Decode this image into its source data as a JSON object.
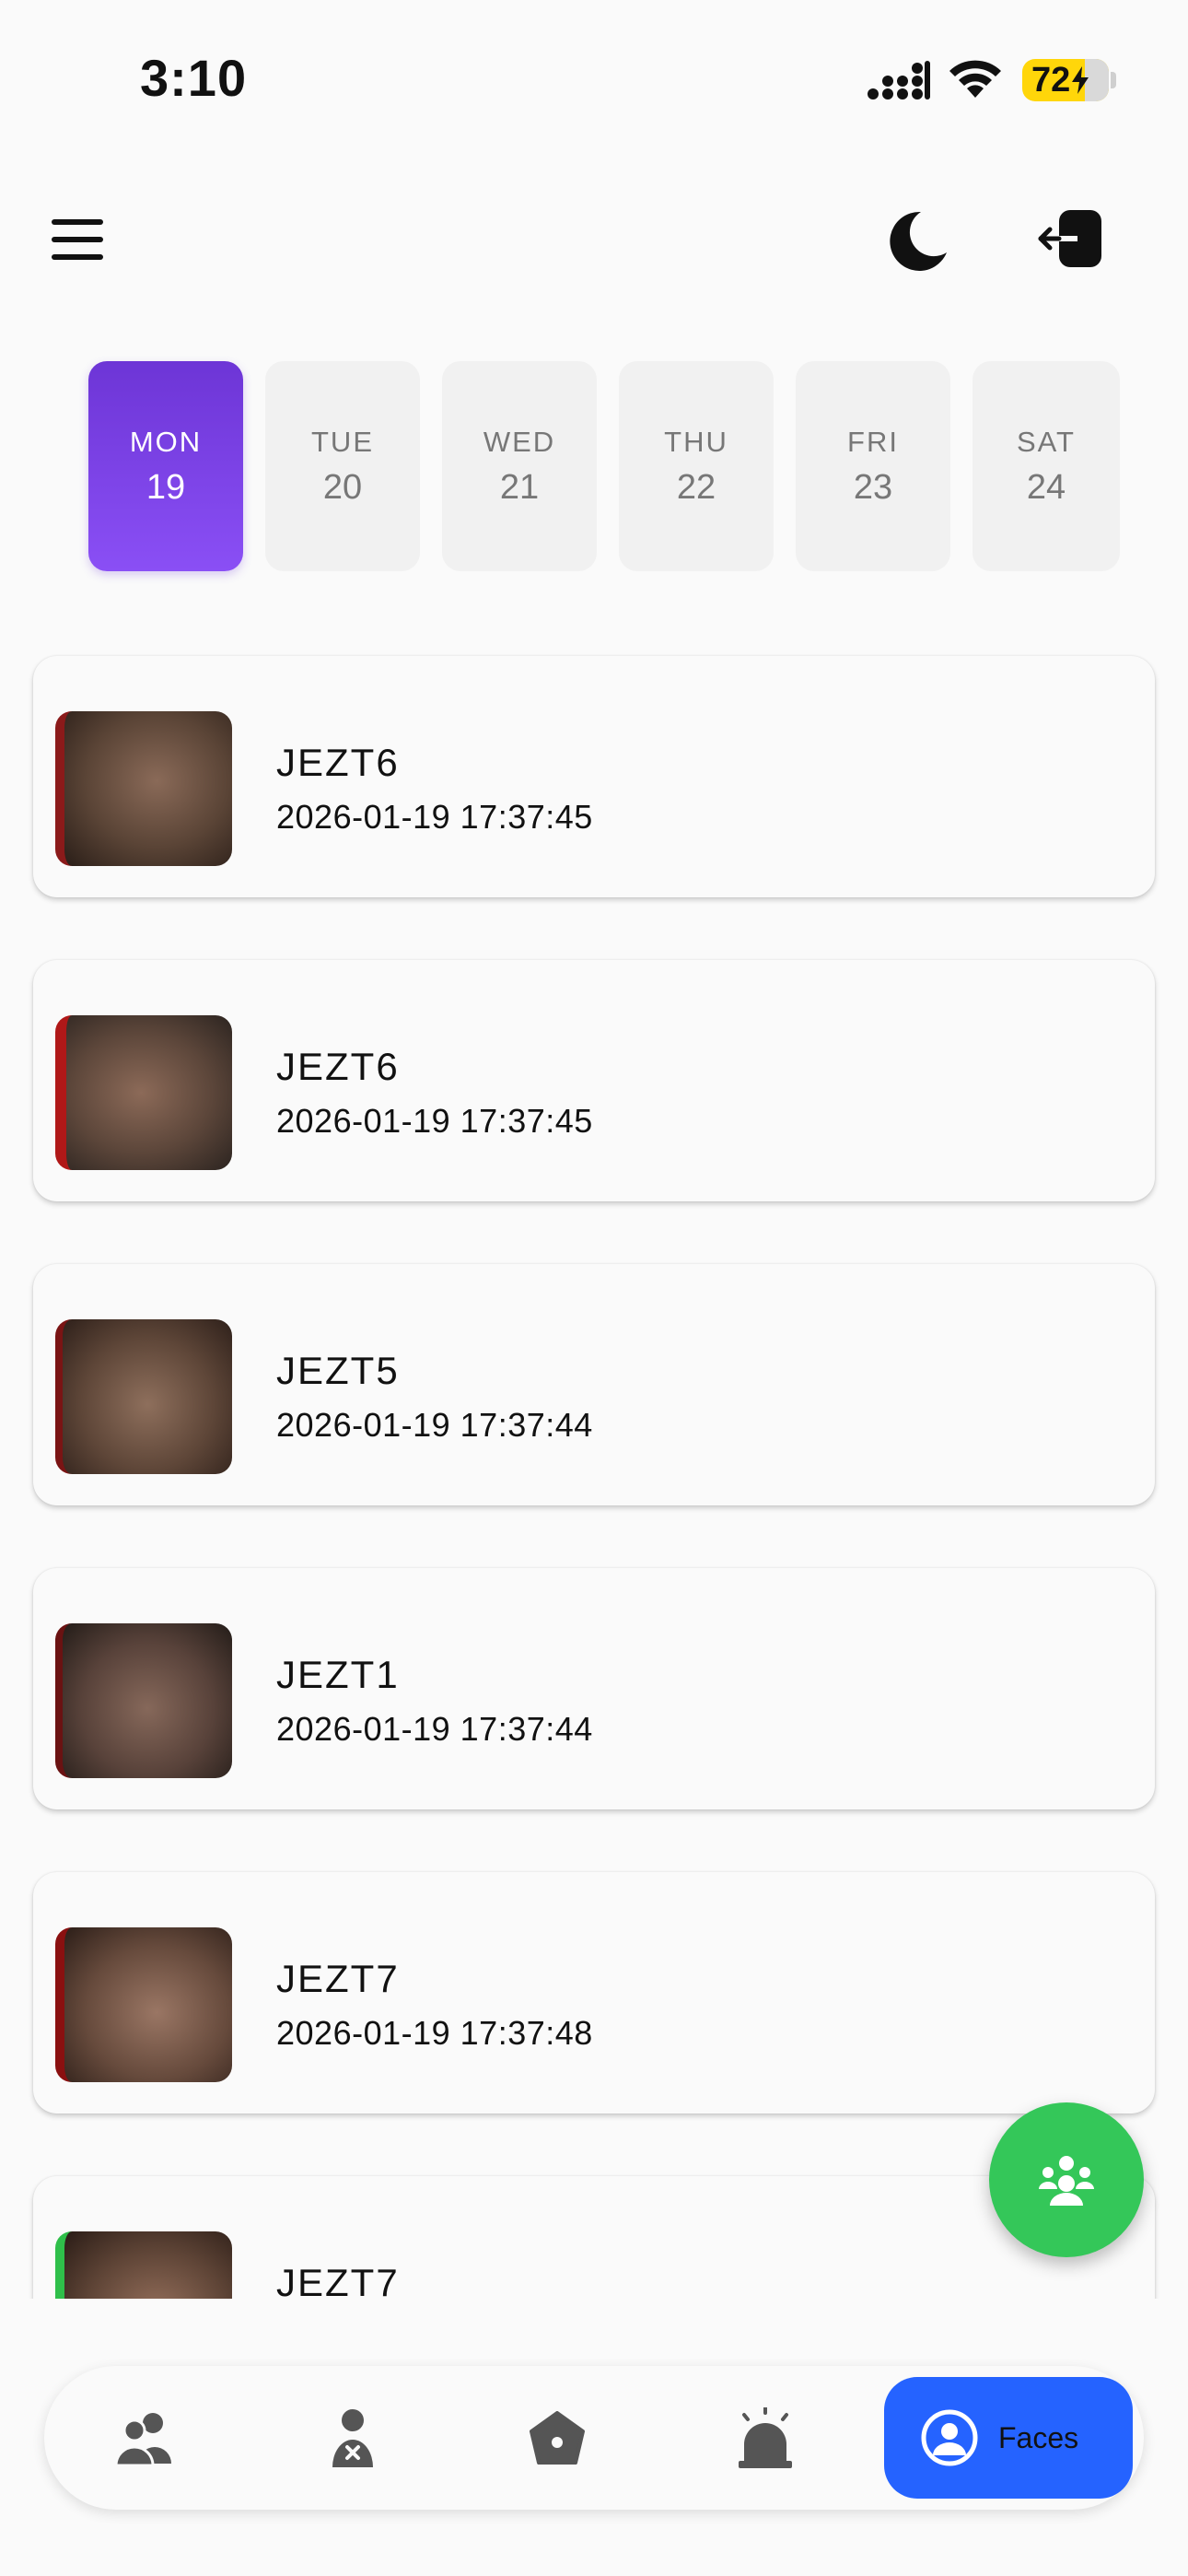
{
  "status_bar": {
    "time": "3:10",
    "battery": "72"
  },
  "header": {
    "menu_icon": "hamburger-menu-icon",
    "theme_icon": "moon-icon",
    "logout_icon": "logout-icon"
  },
  "date_strip": {
    "selected_index": 0,
    "days": [
      {
        "dow": "MON",
        "day": "19"
      },
      {
        "dow": "TUE",
        "day": "20"
      },
      {
        "dow": "WED",
        "day": "21"
      },
      {
        "dow": "THU",
        "day": "22"
      },
      {
        "dow": "FRI",
        "day": "23"
      },
      {
        "dow": "SAT",
        "day": "24"
      }
    ]
  },
  "faces": [
    {
      "name": "JEZT6",
      "timestamp": "2026-01-19 17:37:45"
    },
    {
      "name": "JEZT6",
      "timestamp": "2026-01-19 17:37:45"
    },
    {
      "name": "JEZT5",
      "timestamp": "2026-01-19 17:37:44"
    },
    {
      "name": "JEZT1",
      "timestamp": "2026-01-19 17:37:44"
    },
    {
      "name": "JEZT7",
      "timestamp": "2026-01-19 17:37:48"
    },
    {
      "name": "JEZT7",
      "timestamp": ""
    }
  ],
  "fab": {
    "icon": "group-faces-icon"
  },
  "bottom_nav": {
    "items": [
      {
        "icon": "users-icon"
      },
      {
        "icon": "user-remove-icon"
      },
      {
        "icon": "home-icon"
      },
      {
        "icon": "alarm-siren-icon"
      }
    ],
    "active": {
      "icon": "user-circle-icon",
      "label": "Faces"
    }
  },
  "colors": {
    "accent_purple": "#7c3aed",
    "fab_green": "#34c759",
    "nav_active_blue": "#2563ff",
    "battery_yellow": "#ffd60a"
  }
}
